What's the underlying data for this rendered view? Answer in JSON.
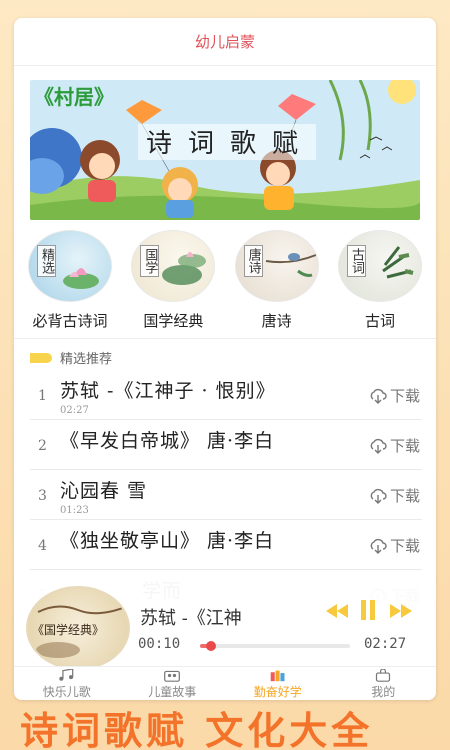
{
  "app": {
    "title": "幼儿启蒙"
  },
  "banner": {
    "tag": "《村居》",
    "heading_chars": [
      "诗",
      "词",
      "歌",
      "赋"
    ]
  },
  "categories": [
    {
      "label": "必背古诗词",
      "circle_text": "精选",
      "bg": "#cfe6f0"
    },
    {
      "label": "国学经典",
      "circle_text": "国学",
      "bg": "#f3efe2"
    },
    {
      "label": "唐诗",
      "circle_text": "唐诗",
      "bg": "#f1ece4"
    },
    {
      "label": "古词",
      "circle_text": "古词",
      "bg": "#eef0ea"
    }
  ],
  "section": {
    "title": "精选推荐"
  },
  "list": {
    "download_label": "下载",
    "items": [
      {
        "num": "1",
        "title": "苏轼 -《江神子 · 恨别》",
        "sub": "02:27"
      },
      {
        "num": "2",
        "title": "《早发白帝城》 唐·李白",
        "sub": ""
      },
      {
        "num": "3",
        "title": "沁园春  雪",
        "sub": "01:23"
      },
      {
        "num": "4",
        "title": "《独坐敬亭山》 唐·李白",
        "sub": ""
      },
      {
        "num": "5",
        "title": "学而",
        "sub": ""
      }
    ]
  },
  "player": {
    "cover_text": "《国学经典》",
    "title": "苏轼 -《江神",
    "time_current": "00:10",
    "time_total": "02:27",
    "progress": 0.07
  },
  "tabs": [
    {
      "label": "快乐儿歌",
      "active": false
    },
    {
      "label": "儿童故事",
      "active": false
    },
    {
      "label": "勤奋好学",
      "active": true
    },
    {
      "label": "我的",
      "active": false
    }
  ],
  "slogan": "诗词歌赋 文化大全",
  "colors": {
    "accent": "#f5a623",
    "title": "#e0525a",
    "slogan": "#f3732a",
    "progress": "#f26b6b"
  }
}
